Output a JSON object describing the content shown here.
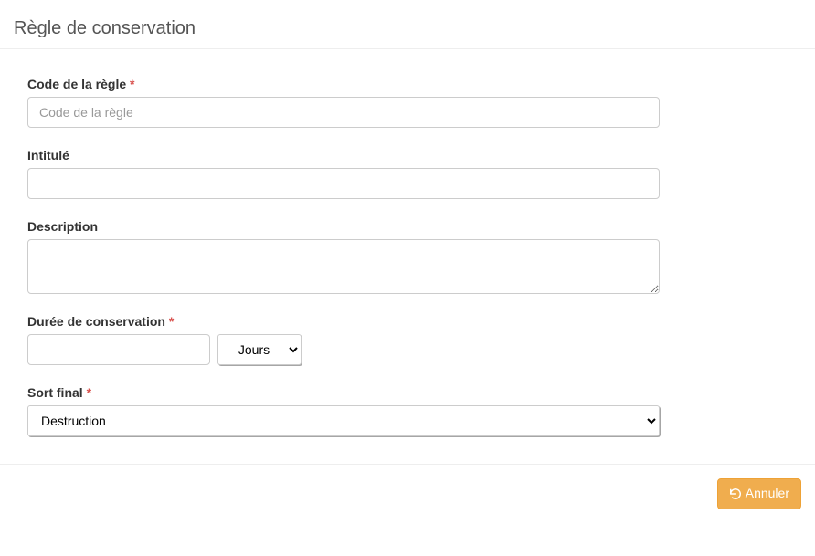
{
  "header": {
    "title": "Règle de conservation"
  },
  "form": {
    "code": {
      "label": "Code de la règle",
      "required_mark": "*",
      "placeholder": "Code de la règle",
      "value": ""
    },
    "intitule": {
      "label": "Intitulé",
      "value": ""
    },
    "description": {
      "label": "Description",
      "value": ""
    },
    "duration": {
      "label": "Durée de conservation",
      "required_mark": "*",
      "value": "",
      "unit_selected": "Jours"
    },
    "final": {
      "label": "Sort final",
      "required_mark": "*",
      "selected": "Destruction"
    }
  },
  "footer": {
    "cancel_label": "Annuler"
  }
}
